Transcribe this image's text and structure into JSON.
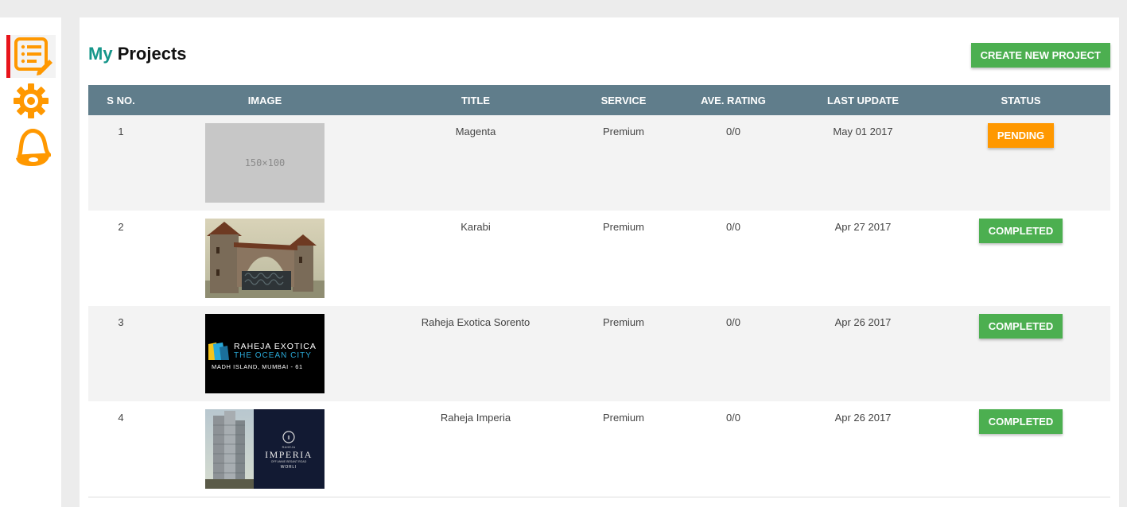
{
  "sidebar": {
    "items": [
      {
        "name": "projects",
        "icon": "list-edit-icon"
      },
      {
        "name": "settings",
        "icon": "gear-icon"
      },
      {
        "name": "notifications",
        "icon": "bell-icon"
      }
    ],
    "accent_color": "#ff9800",
    "active_marker_color": "#e8141b"
  },
  "header": {
    "title_my": "My",
    "title_rest": "Projects",
    "create_button_label": "CREATE NEW PROJECT"
  },
  "table": {
    "columns": [
      "S NO.",
      "IMAGE",
      "TITLE",
      "SERVICE",
      "AVE. RATING",
      "LAST UPDATE",
      "STATUS"
    ],
    "rows": [
      {
        "sno": "1",
        "image": "placeholder",
        "placeholder_text": "150×100",
        "title": "Magenta",
        "service": "Premium",
        "rating": "0/0",
        "updated": "May 01 2017",
        "status": "PENDING",
        "status_type": "pending"
      },
      {
        "sno": "2",
        "image": "stone-arch-gate",
        "title": "Karabi",
        "service": "Premium",
        "rating": "0/0",
        "updated": "Apr 27 2017",
        "status": "COMPLETED",
        "status_type": "completed"
      },
      {
        "sno": "3",
        "image": "raheja-exotica-logo",
        "logo_line1": "RAHEJA EXOTICA",
        "logo_line2": "THE OCEAN CITY",
        "logo_line3": "MADH ISLAND, MUMBAI - 61",
        "title": "Raheja Exotica Sorento",
        "service": "Premium",
        "rating": "0/0",
        "updated": "Apr 26 2017",
        "status": "COMPLETED",
        "status_type": "completed"
      },
      {
        "sno": "4",
        "image": "raheja-imperia-ad",
        "logo_small": "RAHEJA",
        "logo_big": "IMPERIA",
        "logo_sub": "OFF ANNIE BESANT ROAD",
        "logo_city": "WORLI",
        "title": "Raheja Imperia",
        "service": "Premium",
        "rating": "0/0",
        "updated": "Apr 26 2017",
        "status": "COMPLETED",
        "status_type": "completed"
      }
    ]
  },
  "colors": {
    "header_bg": "#607d8b",
    "pending": "#ff9800",
    "completed": "#4caf50",
    "title_accent": "#16968a"
  }
}
